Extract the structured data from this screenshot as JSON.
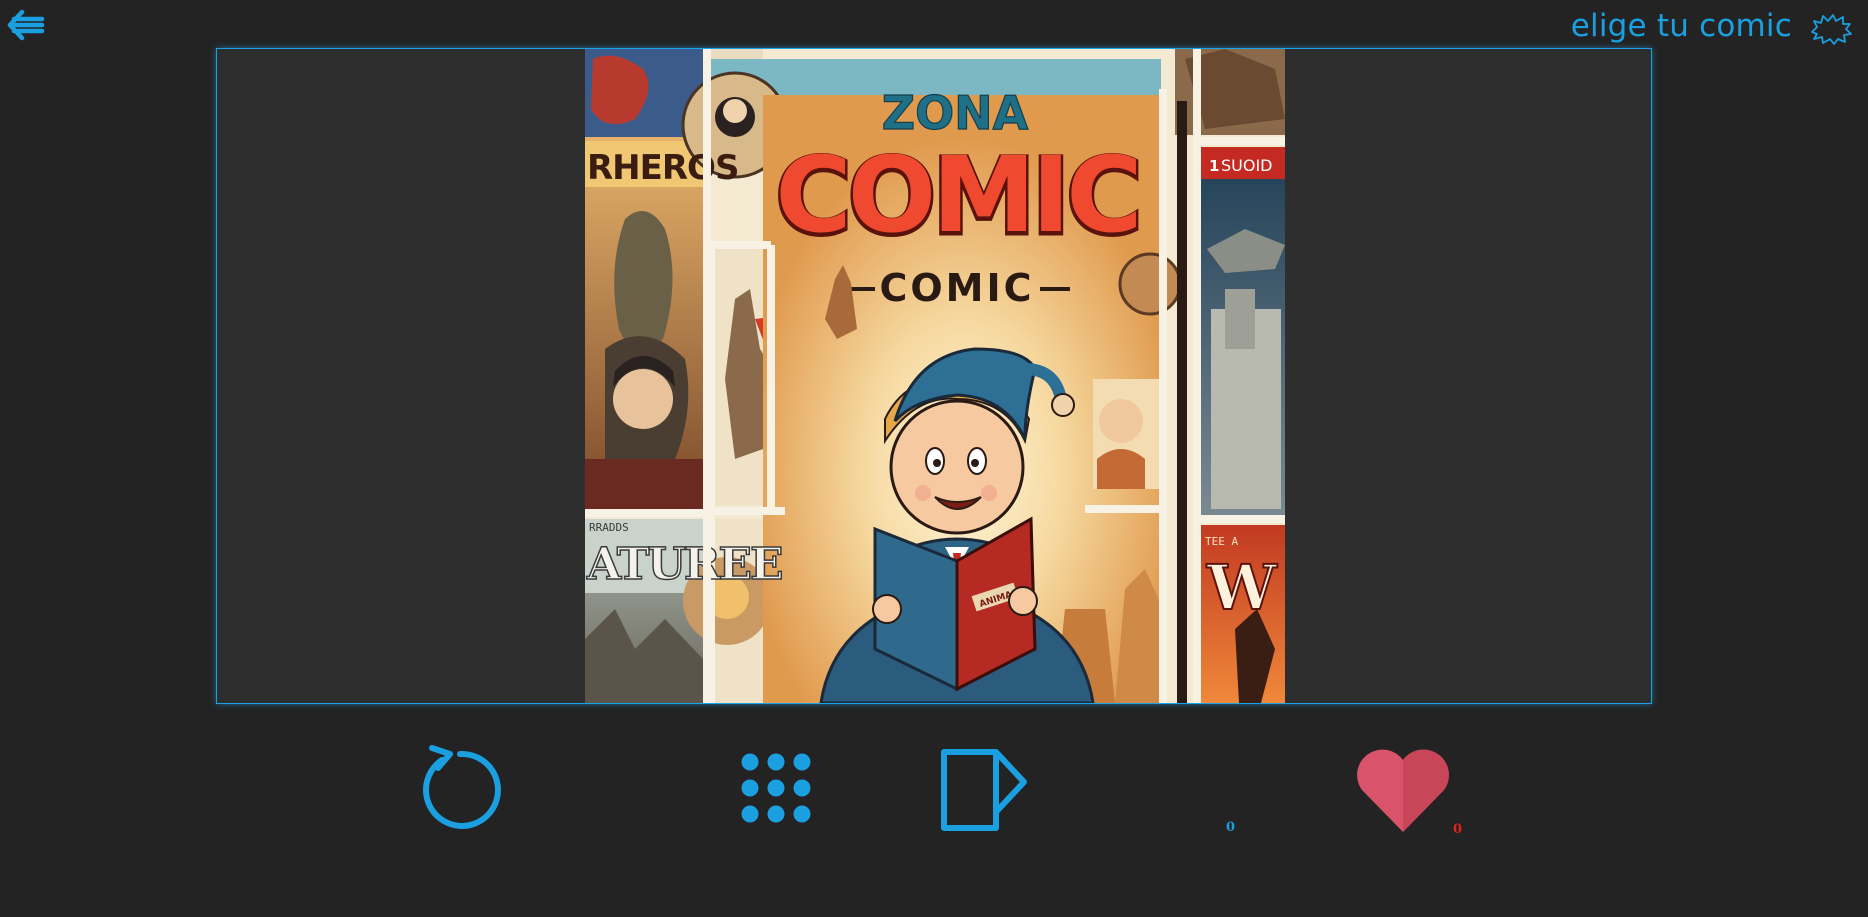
{
  "header": {
    "title": "elige tu comic",
    "back_icon": "arrow-left-bars-icon",
    "burst_icon": "explosion-burst-icon"
  },
  "viewer": {
    "cover": {
      "top_title": "ZONA",
      "big_title": "COMIC",
      "subtitle": "COMIC",
      "left_panel_text": "RHEROS",
      "left_lower_text": "ATUREE",
      "left_lower_small": "RRADDS",
      "right_panel_text": "SUOID",
      "right_panel_number": "1",
      "right_lower_text": "W",
      "right_lower_small": "TEE A",
      "book_label": "ANIMA"
    }
  },
  "controls": {
    "reload_icon": "reload-icon",
    "grid_icon": "grid-dots-icon",
    "page_icon": "page-flip-icon",
    "like_icon": "heart-icon",
    "views_count": "0",
    "likes_count": "0"
  },
  "colors": {
    "accent": "#1a9fe0",
    "background": "#232323",
    "viewer_bg": "#2e2e2e",
    "heart": "#d9546a",
    "like_counter": "#e0241c"
  }
}
